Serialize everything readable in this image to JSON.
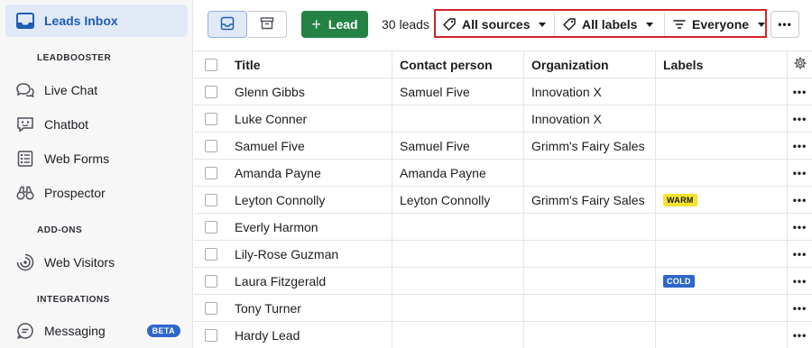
{
  "sidebar": {
    "active_item": {
      "label": "Leads Inbox",
      "icon": "inbox-icon"
    },
    "sections": {
      "leadbooster": "LEADBOOSTER",
      "addons": "ADD-ONS",
      "integrations": "INTEGRATIONS"
    },
    "items": [
      {
        "label": "Live Chat",
        "icon": "live-chat-icon"
      },
      {
        "label": "Chatbot",
        "icon": "chatbot-icon"
      },
      {
        "label": "Web Forms",
        "icon": "web-forms-icon"
      },
      {
        "label": "Prospector",
        "icon": "prospector-icon"
      },
      {
        "label": "Web Visitors",
        "icon": "web-visitors-icon"
      },
      {
        "label": "Messaging",
        "icon": "messaging-icon",
        "badge": "BETA"
      }
    ]
  },
  "toolbar": {
    "add_lead_label": "Lead",
    "lead_count": "30 leads",
    "filters": {
      "sources": "All sources",
      "labels": "All labels",
      "owner": "Everyone"
    },
    "more_label": "•••"
  },
  "table": {
    "headers": {
      "title": "Title",
      "contact": "Contact person",
      "org": "Organization",
      "labels": "Labels"
    },
    "row_action": "•••",
    "rows": [
      {
        "title": "Glenn Gibbs",
        "contact": "Samuel Five",
        "org": "Innovation X",
        "label": ""
      },
      {
        "title": "Luke Conner",
        "contact": "",
        "org": "Innovation X",
        "label": ""
      },
      {
        "title": "Samuel Five",
        "contact": "Samuel Five",
        "org": "Grimm's Fairy Sales",
        "label": ""
      },
      {
        "title": "Amanda Payne",
        "contact": "Amanda Payne",
        "org": "",
        "label": ""
      },
      {
        "title": "Leyton Connolly",
        "contact": "Leyton Connolly",
        "org": "Grimm's Fairy Sales",
        "label": "WARM"
      },
      {
        "title": "Everly Harmon",
        "contact": "",
        "org": "",
        "label": ""
      },
      {
        "title": "Lily-Rose Guzman",
        "contact": "",
        "org": "",
        "label": ""
      },
      {
        "title": "Laura Fitzgerald",
        "contact": "",
        "org": "",
        "label": "COLD"
      },
      {
        "title": "Tony Turner",
        "contact": "",
        "org": "",
        "label": ""
      },
      {
        "title": "Hardy Lead",
        "contact": "",
        "org": "",
        "label": ""
      }
    ]
  },
  "colors": {
    "accent": "#1e5db3",
    "primary_green": "#248245",
    "highlight_red": "#d22328",
    "warm_badge": "#f7e230",
    "cold_badge": "#2e67c9",
    "beta_badge": "#2e67c9"
  }
}
